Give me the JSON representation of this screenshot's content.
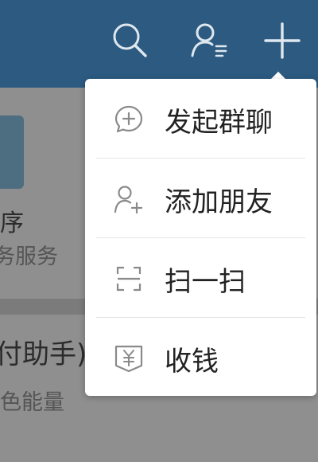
{
  "topbar": {
    "icons": [
      "search-icon",
      "contacts-icon",
      "add-icon"
    ],
    "color": "#2c5a80"
  },
  "background": {
    "mini_program_label": "序",
    "mini_program_sub": "务服务",
    "helper_label": "付助手)",
    "helper_sub": "色能量"
  },
  "menu": {
    "items": [
      {
        "label": "发起群聊",
        "icon": "chat-plus-icon"
      },
      {
        "label": "添加朋友",
        "icon": "add-friend-icon"
      },
      {
        "label": "扫一扫",
        "icon": "scan-icon"
      },
      {
        "label": "收钱",
        "icon": "receive-money-icon"
      }
    ]
  }
}
